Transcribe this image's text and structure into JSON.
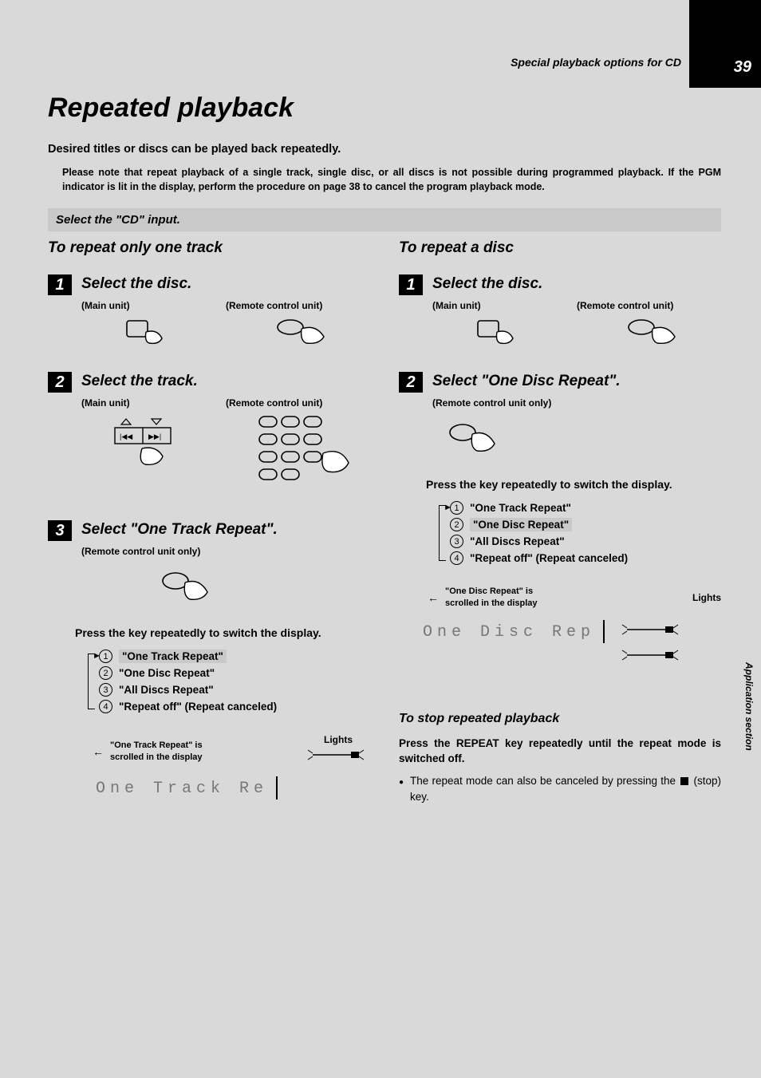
{
  "page_number": "39",
  "breadcrumb": "Special playback options for CD",
  "side_tab": "Application section",
  "title": "Repeated playback",
  "intro_bold": "Desired titles or discs can be played back repeatedly.",
  "intro_note": "Please note that repeat playback of a single track, single disc, or all discs is not possible during programmed playback. If the PGM indicator is lit in the display, perform the procedure on page 38 to cancel the program playback mode.",
  "select_input": "Select the \"CD\" input.",
  "left": {
    "heading": "To repeat only one track",
    "step1_title": "Select the disc.",
    "step2_title": "Select the track.",
    "step3_title": "Select \"One Track Repeat\".",
    "main_unit": "(Main unit)",
    "remote_unit": "(Remote control unit)",
    "remote_only": "(Remote control unit only)",
    "press": "Press the key repeatedly to switch the display.",
    "opts": {
      "o1": "\"One Track Repeat\"",
      "o2": "\"One Disc  Repeat\"",
      "o3": "\"All  Discs Repeat\"",
      "o4": "\"Repeat off\" (Repeat canceled)"
    },
    "scroll_note_l1": "\"One Track  Repeat\" is",
    "scroll_note_l2": "scrolled in the display",
    "lights": "Lights",
    "display": "One Track Re"
  },
  "right": {
    "heading": "To repeat a disc",
    "step1_title": "Select the disc.",
    "step2_title": "Select \"One Disc Repeat\".",
    "main_unit": "(Main unit)",
    "remote_unit": "(Remote control unit)",
    "remote_only": "(Remote control unit only)",
    "press": "Press the key repeatedly to switch the display.",
    "opts": {
      "o1": "\"One Track Repeat\"",
      "o2": "\"One Disc  Repeat\"",
      "o3": "\"All  Discs Repeat\"",
      "o4": "\"Repeat off\" (Repeat canceled)"
    },
    "scroll_note_l1": "\"One Disc Repeat\" is",
    "scroll_note_l2": "scrolled in the display",
    "lights": "Lights",
    "display": "One Disc Rep",
    "stop_heading": "To stop repeated playback",
    "stop_bold": "Press the REPEAT key repeatedly until the repeat mode is switched off.",
    "stop_bullet_a": "The repeat mode can also be canceled by pressing the",
    "stop_bullet_b": "(stop) key."
  }
}
